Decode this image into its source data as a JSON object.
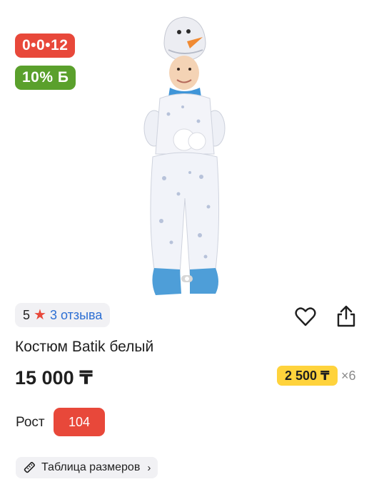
{
  "badges": {
    "installment": "0•0•12",
    "bonus": "10% Б"
  },
  "rating": {
    "value": "5",
    "reviews_label": "3 отзыва"
  },
  "product": {
    "title": "Костюм Batik белый",
    "price": "15 000 ₸"
  },
  "installment": {
    "amount": "2 500 ₸",
    "multiplier": "×6"
  },
  "size": {
    "label": "Рост",
    "selected": "104"
  },
  "size_table": {
    "label": "Таблица размеров"
  },
  "colors": {
    "accent_red": "#e8483a",
    "bonus_green": "#5aa02c",
    "installment_yellow": "#ffd33c",
    "link_blue": "#2d6fd3"
  }
}
